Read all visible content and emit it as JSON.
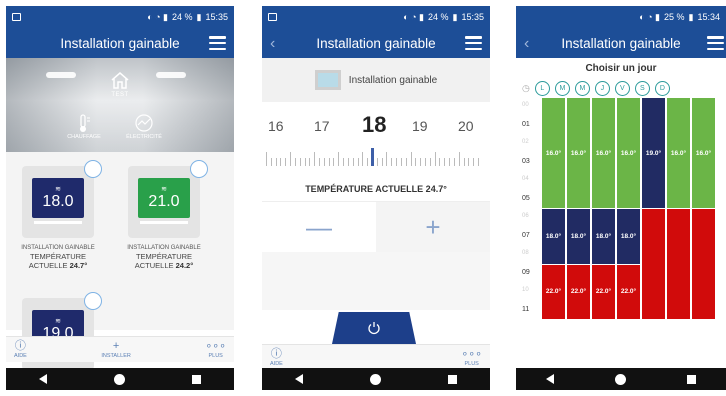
{
  "status": {
    "left_battery": "24 %",
    "left_time": "15:35",
    "mid_battery": "24 %",
    "mid_time": "15:35",
    "right_battery": "25 %",
    "right_time": "15:34"
  },
  "app_title": "Installation gainable",
  "home": {
    "test_label": "TEST",
    "chauffage_label": "CHAUFFAGE",
    "electricite_label": "ÉLECTRICITÉ",
    "tiles": [
      {
        "temp": "18.0",
        "caption1": "INSTALLATION GAINABLE",
        "caption2": "TEMPÉRATURE",
        "caption3": "ACTUELLE",
        "current": "24.7°",
        "color": "#1f2a6b"
      },
      {
        "temp": "21.0",
        "caption1": "INSTALLATION GAINABLE",
        "caption2": "TEMPÉRATURE",
        "caption3": "ACTUELLE",
        "current": "24.2°",
        "color": "#29a04a"
      },
      {
        "temp": "19.0",
        "color": "#1f2a6b"
      }
    ]
  },
  "bottom_nav": {
    "aide": "AIDE",
    "installer": "INSTALLER",
    "plus": "PLUS"
  },
  "detail": {
    "device_label": "Installation gainable",
    "scale": [
      "16",
      "17",
      "18",
      "19",
      "20"
    ],
    "selected": "18",
    "current_temp": "TEMPÉRATURE ACTUELLE 24.7°",
    "minus": "—",
    "plus": "+"
  },
  "schedule": {
    "title": "Choisir un jour",
    "days": [
      "L",
      "M",
      "M",
      "J",
      "V",
      "S",
      "D"
    ],
    "hours": [
      "00",
      "01",
      "02",
      "03",
      "04",
      "05",
      "06",
      "07",
      "08",
      "09",
      "10",
      "11"
    ],
    "columns": [
      [
        {
          "h": 6,
          "t": "16.0°",
          "c": "green"
        },
        {
          "h": 3,
          "t": "18.0°",
          "c": "navy"
        },
        {
          "h": 3,
          "t": "22.0°",
          "c": "red"
        }
      ],
      [
        {
          "h": 6,
          "t": "16.0°",
          "c": "green"
        },
        {
          "h": 3,
          "t": "18.0°",
          "c": "navy"
        },
        {
          "h": 3,
          "t": "22.0°",
          "c": "red"
        }
      ],
      [
        {
          "h": 6,
          "t": "16.0°",
          "c": "green"
        },
        {
          "h": 3,
          "t": "18.0°",
          "c": "navy"
        },
        {
          "h": 3,
          "t": "22.0°",
          "c": "red"
        }
      ],
      [
        {
          "h": 6,
          "t": "16.0°",
          "c": "green"
        },
        {
          "h": 3,
          "t": "18.0°",
          "c": "navy"
        },
        {
          "h": 3,
          "t": "22.0°",
          "c": "red"
        }
      ],
      [
        {
          "h": 6,
          "t": "19.0°",
          "c": "navy"
        },
        {
          "h": 6,
          "t": "",
          "c": "red"
        }
      ],
      [
        {
          "h": 6,
          "t": "16.0°",
          "c": "green"
        },
        {
          "h": 6,
          "t": "",
          "c": "red"
        }
      ],
      [
        {
          "h": 6,
          "t": "16.0°",
          "c": "green"
        },
        {
          "h": 6,
          "t": "",
          "c": "red"
        }
      ]
    ]
  }
}
